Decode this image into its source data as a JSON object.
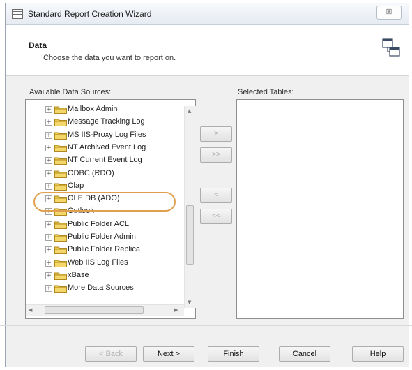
{
  "window": {
    "title": "Standard Report Creation Wizard",
    "close_glyph": "⊠"
  },
  "header": {
    "title": "Data",
    "subtitle": "Choose the data you want to report on.",
    "icon": "data-tables-icon"
  },
  "available": {
    "label": "Available Data Sources:",
    "items": [
      {
        "label": "Mailbox Admin"
      },
      {
        "label": "Message Tracking Log"
      },
      {
        "label": "MS IIS-Proxy Log Files"
      },
      {
        "label": "NT Archived Event Log"
      },
      {
        "label": "NT Current Event Log"
      },
      {
        "label": "ODBC (RDO)"
      },
      {
        "label": "Olap"
      },
      {
        "label": "OLE DB (ADO)",
        "highlighted": true
      },
      {
        "label": "Outlook"
      },
      {
        "label": "Public Folder ACL"
      },
      {
        "label": "Public Folder Admin"
      },
      {
        "label": "Public Folder Replica"
      },
      {
        "label": "Web IIS Log Files"
      },
      {
        "label": "xBase"
      },
      {
        "label": "More Data Sources"
      }
    ]
  },
  "selected": {
    "label": "Selected Tables:"
  },
  "move_buttons": [
    ">",
    ">>",
    "<",
    "<<"
  ],
  "buttons": {
    "back": "< Back",
    "next": "Next >",
    "finish": "Finish",
    "cancel": "Cancel",
    "help": "Help"
  },
  "colors": {
    "highlight": "#e0a050",
    "folder": "#e8c64a"
  }
}
